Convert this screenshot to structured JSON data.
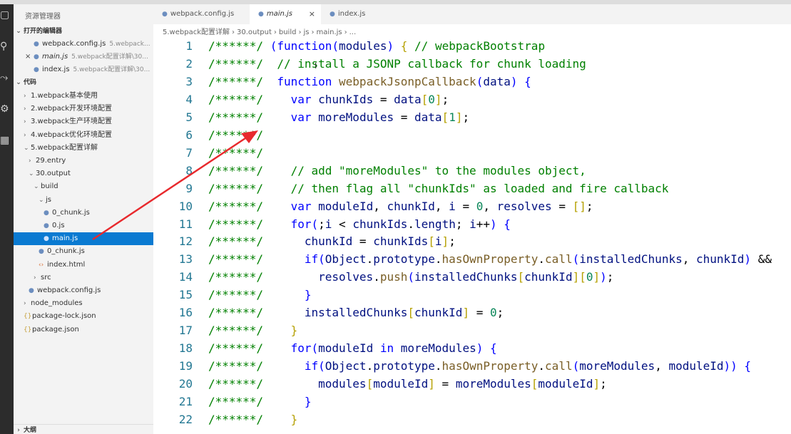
{
  "explorer": {
    "title": "资源管理器",
    "open_editors": {
      "label": "打开的编辑器",
      "items": [
        {
          "name": "webpack.config.js",
          "desc": "5.webpack..."
        },
        {
          "name": "main.js",
          "desc": "5.webpack配置详解\\30..."
        },
        {
          "name": "index.js",
          "desc": "5.webpack配置详解\\30..."
        }
      ]
    },
    "folder": {
      "label": "代码",
      "items": [
        {
          "name": "1.webpack基本使用",
          "type": "folder",
          "expanded": false
        },
        {
          "name": "2.webpack开发环境配置",
          "type": "folder",
          "expanded": false
        },
        {
          "name": "3.webpack生产环境配置",
          "type": "folder",
          "expanded": false
        },
        {
          "name": "4.webpack优化环境配置",
          "type": "folder",
          "expanded": false
        },
        {
          "name": "5.webpack配置详解",
          "type": "folder",
          "expanded": true
        },
        {
          "name": "29.entry",
          "type": "folder",
          "expanded": false
        },
        {
          "name": "30.output",
          "type": "folder",
          "expanded": true
        },
        {
          "name": "build",
          "type": "folder",
          "expanded": true
        },
        {
          "name": "js",
          "type": "folder",
          "expanded": true
        },
        {
          "name": "0_chunk.js",
          "type": "file"
        },
        {
          "name": "0.js",
          "type": "file"
        },
        {
          "name": "main.js",
          "type": "file",
          "selected": true
        },
        {
          "name": "0_chunk.js",
          "type": "file"
        },
        {
          "name": "index.html",
          "type": "html"
        },
        {
          "name": "src",
          "type": "folder",
          "expanded": false
        },
        {
          "name": "webpack.config.js",
          "type": "file"
        },
        {
          "name": "node_modules",
          "type": "folder",
          "expanded": false
        },
        {
          "name": "package-lock.json",
          "type": "json"
        },
        {
          "name": "package.json",
          "type": "json"
        }
      ]
    },
    "outline_label": "大纲"
  },
  "tabs": [
    {
      "label": "webpack.config.js",
      "active": false
    },
    {
      "label": "main.js",
      "active": true,
      "italic": true,
      "close": "×"
    },
    {
      "label": "index.js",
      "active": false
    }
  ],
  "breadcrumb": [
    "5.webpack配置详解",
    "30.output",
    "build",
    "js",
    "main.js",
    "..."
  ],
  "line_numbers": [
    "1",
    "2",
    "3",
    "4",
    "5",
    "6",
    "7",
    "8",
    "9",
    "10",
    "11",
    "12",
    "13",
    "14",
    "15",
    "16",
    "17",
    "18",
    "19",
    "20",
    "21",
    "22"
  ],
  "code_lines": [
    [
      [
        "cm",
        "/******/ "
      ],
      [
        "kw",
        "("
      ],
      [
        "kw",
        "function"
      ],
      [
        "kw",
        "("
      ],
      [
        "id",
        "modules"
      ],
      [
        "kw",
        ")"
      ],
      [
        "pn",
        " "
      ],
      [
        "br",
        "{"
      ],
      [
        "pn",
        " "
      ],
      [
        "cm",
        "// webpackBootstrap"
      ]
    ],
    [
      [
        "cm",
        "/******/  // install a JSONP callback for chunk loading"
      ]
    ],
    [
      [
        "cm",
        "/******/  "
      ],
      [
        "kw",
        "function"
      ],
      [
        "pn",
        " "
      ],
      [
        "fn",
        "webpackJsonpCallback"
      ],
      [
        "kw",
        "("
      ],
      [
        "id",
        "data"
      ],
      [
        "kw",
        ")"
      ],
      [
        "pn",
        " "
      ],
      [
        "kw",
        "{"
      ]
    ],
    [
      [
        "cm",
        "/******/    "
      ],
      [
        "kw",
        "var"
      ],
      [
        "pn",
        " "
      ],
      [
        "id",
        "chunkIds"
      ],
      [
        "pn",
        " = "
      ],
      [
        "id",
        "data"
      ],
      [
        "br",
        "["
      ],
      [
        "num",
        "0"
      ],
      [
        "br",
        "]"
      ],
      [
        "pn",
        ";"
      ]
    ],
    [
      [
        "cm",
        "/******/    "
      ],
      [
        "kw",
        "var"
      ],
      [
        "pn",
        " "
      ],
      [
        "id",
        "moreModules"
      ],
      [
        "pn",
        " = "
      ],
      [
        "id",
        "data"
      ],
      [
        "br",
        "["
      ],
      [
        "num",
        "1"
      ],
      [
        "br",
        "]"
      ],
      [
        "pn",
        ";"
      ]
    ],
    [
      [
        "cm",
        "/******/"
      ]
    ],
    [
      [
        "cm",
        "/******/"
      ]
    ],
    [
      [
        "cm",
        "/******/    // add \"moreModules\" to the modules object,"
      ]
    ],
    [
      [
        "cm",
        "/******/    // then flag all \"chunkIds\" as loaded and fire callback"
      ]
    ],
    [
      [
        "cm",
        "/******/    "
      ],
      [
        "kw",
        "var"
      ],
      [
        "pn",
        " "
      ],
      [
        "id",
        "moduleId"
      ],
      [
        "pn",
        ", "
      ],
      [
        "id",
        "chunkId"
      ],
      [
        "pn",
        ", "
      ],
      [
        "id",
        "i"
      ],
      [
        "pn",
        " = "
      ],
      [
        "num",
        "0"
      ],
      [
        "pn",
        ", "
      ],
      [
        "id",
        "resolves"
      ],
      [
        "pn",
        " = "
      ],
      [
        "br",
        "[]"
      ],
      [
        "pn",
        ";"
      ]
    ],
    [
      [
        "cm",
        "/******/    "
      ],
      [
        "kw",
        "for"
      ],
      [
        "kw",
        "("
      ],
      [
        "pn",
        ";"
      ],
      [
        "id",
        "i"
      ],
      [
        "pn",
        " < "
      ],
      [
        "id",
        "chunkIds"
      ],
      [
        "pn",
        "."
      ],
      [
        "id",
        "length"
      ],
      [
        "pn",
        "; "
      ],
      [
        "id",
        "i"
      ],
      [
        "pn",
        "++"
      ],
      [
        "kw",
        ")"
      ],
      [
        "pn",
        " "
      ],
      [
        "kw",
        "{"
      ]
    ],
    [
      [
        "cm",
        "/******/      "
      ],
      [
        "id",
        "chunkId"
      ],
      [
        "pn",
        " = "
      ],
      [
        "id",
        "chunkIds"
      ],
      [
        "br",
        "["
      ],
      [
        "id",
        "i"
      ],
      [
        "br",
        "]"
      ],
      [
        "pn",
        ";"
      ]
    ],
    [
      [
        "cm",
        "/******/      "
      ],
      [
        "kw",
        "if"
      ],
      [
        "kw",
        "("
      ],
      [
        "id",
        "Object"
      ],
      [
        "pn",
        "."
      ],
      [
        "id",
        "prototype"
      ],
      [
        "pn",
        "."
      ],
      [
        "fn",
        "hasOwnProperty"
      ],
      [
        "pn",
        "."
      ],
      [
        "fn",
        "call"
      ],
      [
        "kw",
        "("
      ],
      [
        "id",
        "installedChunks"
      ],
      [
        "pn",
        ", "
      ],
      [
        "id",
        "chunkId"
      ],
      [
        "kw",
        ")"
      ],
      [
        "pn",
        " &&"
      ]
    ],
    [
      [
        "cm",
        "/******/        "
      ],
      [
        "id",
        "resolves"
      ],
      [
        "pn",
        "."
      ],
      [
        "fn",
        "push"
      ],
      [
        "kw",
        "("
      ],
      [
        "id",
        "installedChunks"
      ],
      [
        "br",
        "["
      ],
      [
        "id",
        "chunkId"
      ],
      [
        "br",
        "]["
      ],
      [
        "num",
        "0"
      ],
      [
        "br",
        "]"
      ],
      [
        "kw",
        ")"
      ],
      [
        "pn",
        ";"
      ]
    ],
    [
      [
        "cm",
        "/******/      "
      ],
      [
        "kw",
        "}"
      ]
    ],
    [
      [
        "cm",
        "/******/      "
      ],
      [
        "id",
        "installedChunks"
      ],
      [
        "br",
        "["
      ],
      [
        "id",
        "chunkId"
      ],
      [
        "br",
        "]"
      ],
      [
        "pn",
        " = "
      ],
      [
        "num",
        "0"
      ],
      [
        "pn",
        ";"
      ]
    ],
    [
      [
        "cm",
        "/******/    "
      ],
      [
        "br",
        "}"
      ]
    ],
    [
      [
        "cm",
        "/******/    "
      ],
      [
        "kw",
        "for"
      ],
      [
        "kw",
        "("
      ],
      [
        "id",
        "moduleId"
      ],
      [
        "pn",
        " "
      ],
      [
        "kw",
        "in"
      ],
      [
        "pn",
        " "
      ],
      [
        "id",
        "moreModules"
      ],
      [
        "kw",
        ")"
      ],
      [
        "pn",
        " "
      ],
      [
        "kw",
        "{"
      ]
    ],
    [
      [
        "cm",
        "/******/      "
      ],
      [
        "kw",
        "if"
      ],
      [
        "kw",
        "("
      ],
      [
        "id",
        "Object"
      ],
      [
        "pn",
        "."
      ],
      [
        "id",
        "prototype"
      ],
      [
        "pn",
        "."
      ],
      [
        "fn",
        "hasOwnProperty"
      ],
      [
        "pn",
        "."
      ],
      [
        "fn",
        "call"
      ],
      [
        "kw",
        "("
      ],
      [
        "id",
        "moreModules"
      ],
      [
        "pn",
        ", "
      ],
      [
        "id",
        "moduleId"
      ],
      [
        "kw",
        "))"
      ],
      [
        "pn",
        " "
      ],
      [
        "kw",
        "{"
      ]
    ],
    [
      [
        "cm",
        "/******/        "
      ],
      [
        "id",
        "modules"
      ],
      [
        "br",
        "["
      ],
      [
        "id",
        "moduleId"
      ],
      [
        "br",
        "]"
      ],
      [
        "pn",
        " = "
      ],
      [
        "id",
        "moreModules"
      ],
      [
        "br",
        "["
      ],
      [
        "id",
        "moduleId"
      ],
      [
        "br",
        "]"
      ],
      [
        "pn",
        ";"
      ]
    ],
    [
      [
        "cm",
        "/******/      "
      ],
      [
        "kw",
        "}"
      ]
    ],
    [
      [
        "cm",
        "/******/    "
      ],
      [
        "br",
        "}"
      ]
    ]
  ],
  "colors": {
    "selection": "#0a7ad1",
    "comment": "#008000",
    "keyword": "#0000ff",
    "arrow": "#e8292d"
  }
}
